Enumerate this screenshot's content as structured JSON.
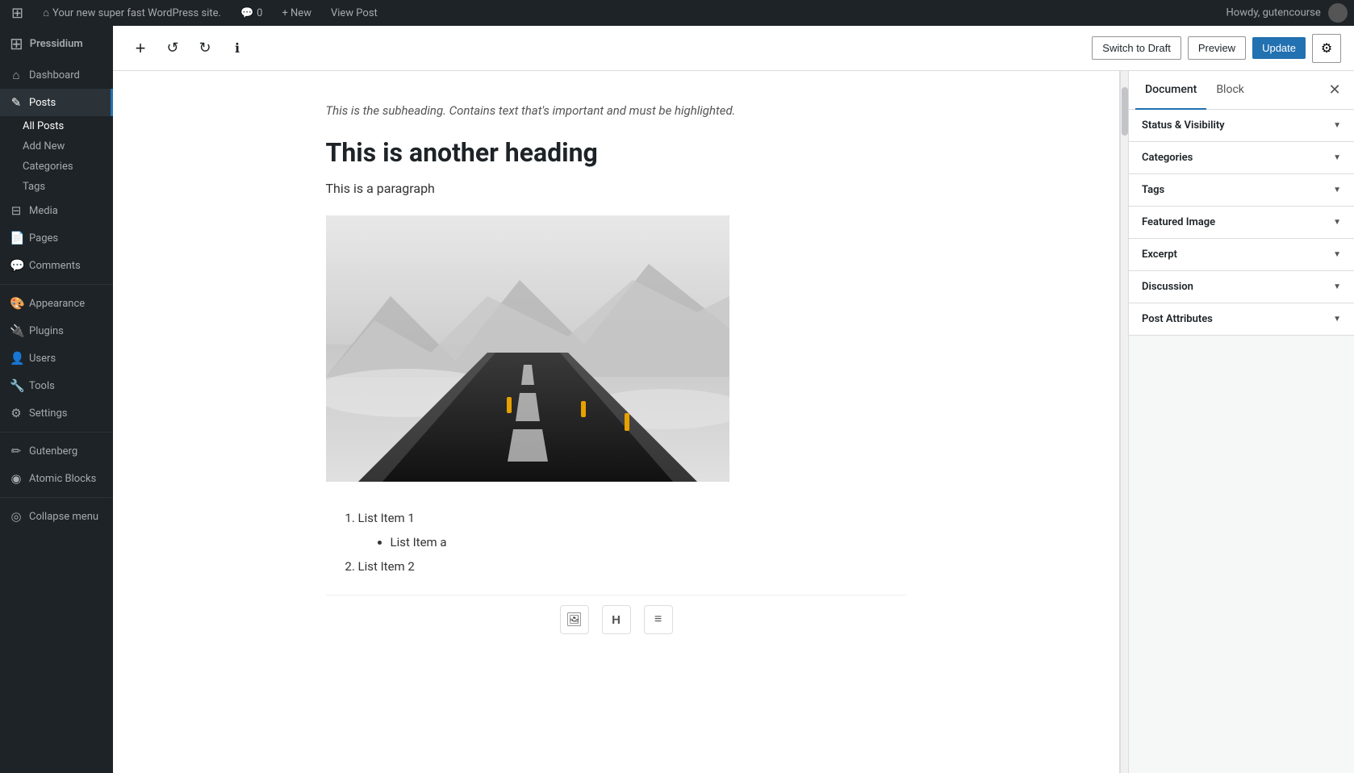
{
  "adminBar": {
    "wpLogo": "⊞",
    "siteName": "Your new super fast WordPress site.",
    "commentsIcon": "💬",
    "commentsCount": "0",
    "newLabel": "+ New",
    "viewPostLabel": "View Post",
    "greetingLabel": "Howdy, gutencourse"
  },
  "sidebar": {
    "logoIcon": "⊞",
    "brandName": "Pressidium",
    "items": [
      {
        "id": "dashboard",
        "icon": "⌂",
        "label": "Dashboard"
      },
      {
        "id": "posts",
        "icon": "✎",
        "label": "Posts",
        "active": true
      },
      {
        "id": "media",
        "icon": "⊟",
        "label": "Media"
      },
      {
        "id": "pages",
        "icon": "📄",
        "label": "Pages"
      },
      {
        "id": "comments",
        "icon": "💬",
        "label": "Comments"
      },
      {
        "id": "appearance",
        "icon": "🎨",
        "label": "Appearance"
      },
      {
        "id": "plugins",
        "icon": "🔌",
        "label": "Plugins"
      },
      {
        "id": "users",
        "icon": "👤",
        "label": "Users"
      },
      {
        "id": "tools",
        "icon": "🔧",
        "label": "Tools"
      },
      {
        "id": "settings",
        "icon": "⚙",
        "label": "Settings"
      },
      {
        "id": "gutenberg",
        "icon": "✏",
        "label": "Gutenberg"
      },
      {
        "id": "atomic-blocks",
        "icon": "◉",
        "label": "Atomic Blocks"
      }
    ],
    "postsSubItems": [
      {
        "id": "all-posts",
        "label": "All Posts",
        "active": true
      },
      {
        "id": "add-new",
        "label": "Add New"
      },
      {
        "id": "categories",
        "label": "Categories"
      },
      {
        "id": "tags",
        "label": "Tags"
      }
    ],
    "collapseLabel": "Collapse menu"
  },
  "toolbar": {
    "addBlockIcon": "+",
    "undoIcon": "↺",
    "redoIcon": "↻",
    "infoIcon": "ℹ",
    "switchToDraftLabel": "Switch to Draft",
    "previewLabel": "Preview",
    "updateLabel": "Update",
    "settingsIcon": "⚙"
  },
  "content": {
    "subheading": "This is the subheading. Contains text that's important and must be highlighted.",
    "heading": "This is another heading",
    "paragraph": "This is a paragraph",
    "listItems": [
      {
        "text": "List Item 1",
        "subItems": [
          "List Item a"
        ]
      },
      {
        "text": "List Item 2",
        "subItems": []
      }
    ]
  },
  "rightPanel": {
    "documentTabLabel": "Document",
    "blockTabLabel": "Block",
    "closeIcon": "✕",
    "sections": [
      {
        "id": "status-visibility",
        "label": "Status & Visibility"
      },
      {
        "id": "categories",
        "label": "Categories"
      },
      {
        "id": "tags",
        "label": "Tags"
      },
      {
        "id": "featured-image",
        "label": "Featured Image"
      },
      {
        "id": "excerpt",
        "label": "Excerpt"
      },
      {
        "id": "discussion",
        "label": "Discussion"
      },
      {
        "id": "post-attributes",
        "label": "Post Attributes"
      }
    ]
  },
  "blockToolbar": {
    "imageIcon": "🖼",
    "headingIcon": "H",
    "listIcon": "≡"
  }
}
